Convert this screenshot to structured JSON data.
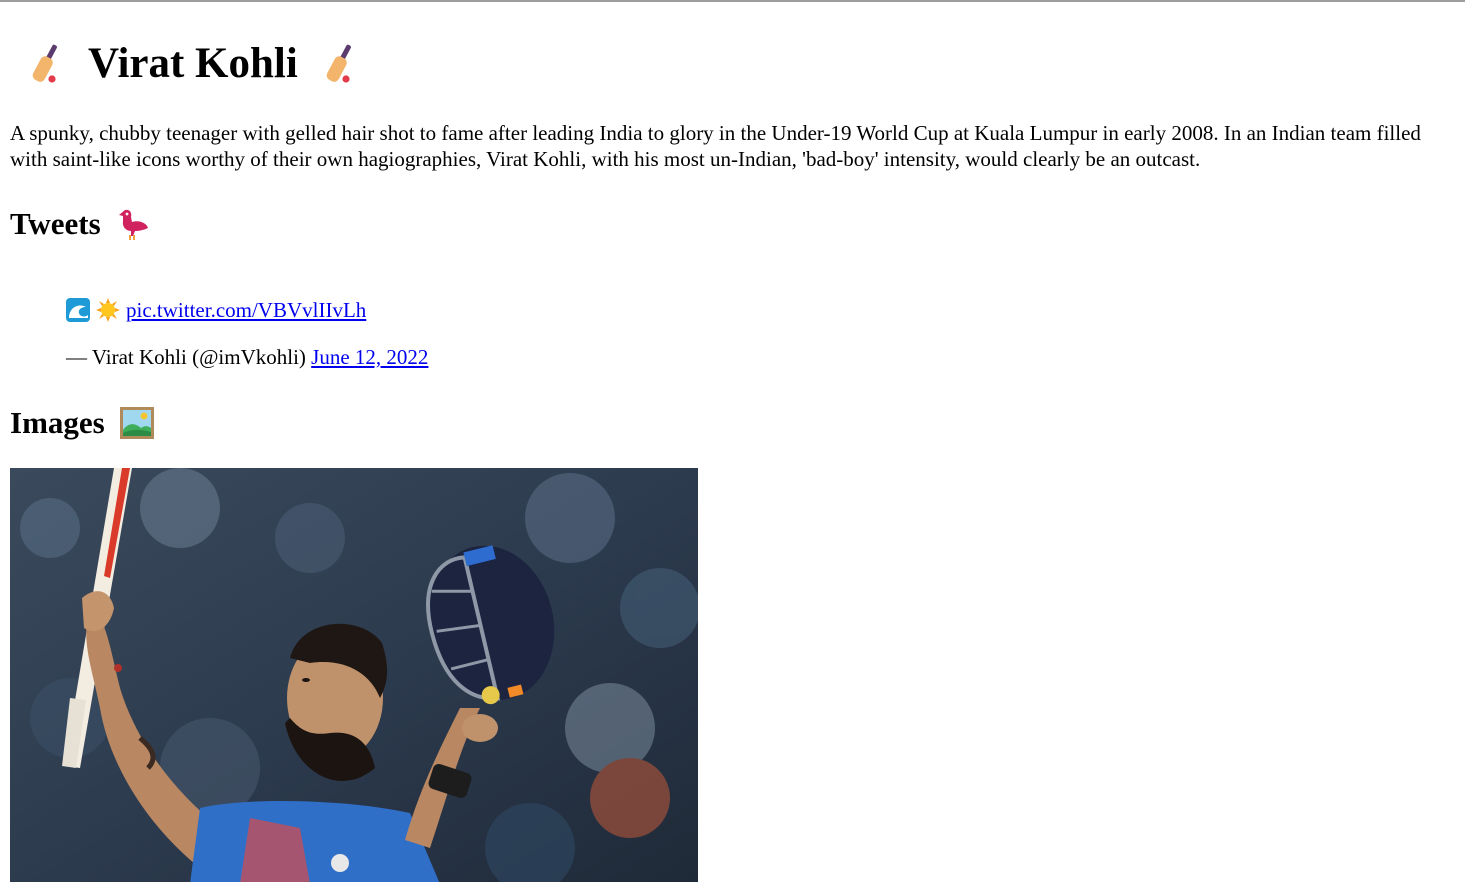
{
  "page": {
    "title": "Virat Kohli",
    "title_emoji": "cricket-bat-icon",
    "bio": "A spunky, chubby teenager with gelled hair shot to fame after leading India to glory in the Under-19 World Cup at Kuala Lumpur in early 2008. In an Indian team filled with saint-like icons worthy of their own hagiographies, Virat Kohli, with his most un-Indian, 'bad-boy' intensity, would clearly be an outcast."
  },
  "tweets": {
    "heading": "Tweets",
    "heading_emoji": "bird-icon",
    "items": [
      {
        "emojis": [
          "wave-icon",
          "sun-icon"
        ],
        "link_text": "pic.twitter.com/VBVvlIIvLh",
        "attribution": "— Virat Kohli (@imVkohli)",
        "date": "June 12, 2022"
      }
    ]
  },
  "images": {
    "heading": "Images",
    "heading_emoji": "framed-picture-icon",
    "photo_subject": "cricketer-raising-bat-and-helmet"
  },
  "colors": {
    "link": "#0000ee",
    "text": "#000000",
    "background": "#ffffff",
    "top_border": "#9e9e9e"
  }
}
